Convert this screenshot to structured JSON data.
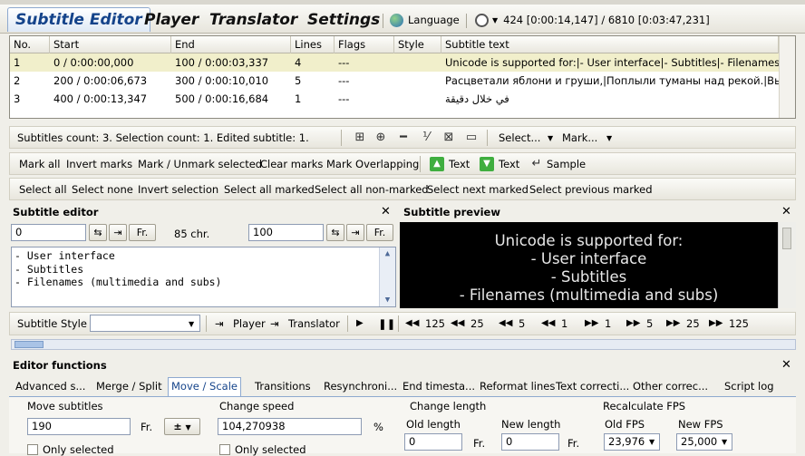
{
  "main_tabs": [
    "Subtitle Editor",
    "Player",
    "Translator",
    "Settings"
  ],
  "language_label": "Language",
  "time_status": "424 [0:00:14,147] / 6810 [0:03:47,231]",
  "grid": {
    "columns": [
      "No.",
      "Start",
      "End",
      "Lines",
      "Flags",
      "Style",
      "Subtitle text"
    ],
    "rows": [
      {
        "no": "1",
        "start": "0 / 0:00:00,000",
        "end": "100 / 0:00:03,337",
        "lines": "4",
        "flags": "---",
        "style": "",
        "text": "Unicode is supported for:|- User interface|- Subtitles|- Filenames (..."
      },
      {
        "no": "2",
        "start": "200 / 0:00:06,673",
        "end": "300 / 0:00:10,010",
        "lines": "5",
        "flags": "---",
        "style": "",
        "text": "Расцветали яблони и груши,|Поплыли туманы над рекой.|Вых..."
      },
      {
        "no": "3",
        "start": "400 / 0:00:13,347",
        "end": "500 / 0:00:16,684",
        "lines": "1",
        "flags": "---",
        "style": "",
        "text": "في خلال دقيقة"
      }
    ]
  },
  "status_bar": {
    "text": "Subtitles count: 3.   Selection count: 1.   Edited subtitle: 1.",
    "select_menu": "Select...",
    "mark_menu": "Mark..."
  },
  "mark_toolbar": {
    "mark_all": "Mark all",
    "invert_marks": "Invert marks",
    "mark_unmark": "Mark / Unmark selected",
    "clear_marks": "Clear marks",
    "mark_overlapping": "Mark Overlapping",
    "text_up": "Text",
    "text_down": "Text",
    "sample": "Sample"
  },
  "select_toolbar": [
    "Select all",
    "Select none",
    "Invert selection",
    "Select all marked",
    "Select all non-marked",
    "Select next marked",
    "Select previous marked"
  ],
  "subtitle_editor": {
    "title": "Subtitle editor",
    "start_value": "0",
    "fr_label": "Fr.",
    "chars": "85 chr.",
    "end_value": "100",
    "fr_label2": "Fr.",
    "text_lines": [
      "- User interface",
      "- Subtitles",
      "- Filenames (multimedia and subs)"
    ]
  },
  "subtitle_preview": {
    "title": "Subtitle preview",
    "lines": [
      "Unicode is supported for:",
      "- User interface",
      "- Subtitles",
      "- Filenames (multimedia and subs)"
    ]
  },
  "style_bar": {
    "label": "Subtitle Style",
    "player": "Player",
    "translator": "Translator",
    "steps": [
      "125",
      "25",
      "5",
      "1",
      "1",
      "5",
      "25",
      "125"
    ]
  },
  "editor_functions": {
    "title": "Editor functions",
    "tabs": [
      "Advanced s...",
      "Merge / Split",
      "Move / Scale",
      "Transitions",
      "Resynchroni...",
      "End timesta...",
      "Reformat lines",
      "Text correcti...",
      "Other correc...",
      "Script log"
    ],
    "move_subtitles": {
      "label": "Move subtitles",
      "value": "190",
      "fr": "Fr.",
      "sign": "±",
      "only_selected": "Only selected"
    },
    "change_speed": {
      "label": "Change speed",
      "value": "104,270938",
      "unit": "%",
      "only_selected": "Only selected"
    },
    "change_length": {
      "label": "Change length",
      "old_label": "Old length",
      "old_value": "0",
      "new_label": "New length",
      "new_value": "0",
      "fr": "Fr."
    },
    "recalc_fps": {
      "label": "Recalculate FPS",
      "old_label": "Old FPS",
      "old_value": "23,976",
      "new_label": "New FPS",
      "new_value": "25,000"
    }
  },
  "colors": {
    "accent": "#14438a",
    "selected_row": "#f1efcb",
    "preview_bg": "#000000"
  }
}
